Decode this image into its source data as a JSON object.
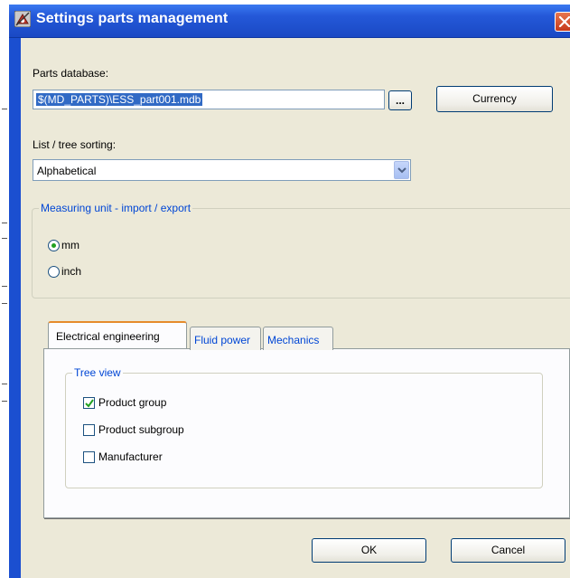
{
  "window": {
    "title": "Settings parts management",
    "app_icon": "settings-parts-icon",
    "close_icon": "close-icon"
  },
  "parts_database": {
    "label": "Parts database:",
    "value": "$(MD_PARTS)\\ESS_part001.mdb",
    "browse_label": "...",
    "currency_label": "Currency"
  },
  "sorting": {
    "label": "List / tree sorting:",
    "selected": "Alphabetical"
  },
  "measuring_unit": {
    "legend": "Measuring unit - import / export",
    "options": [
      {
        "label": "mm",
        "checked": true
      },
      {
        "label": "inch",
        "checked": false
      }
    ]
  },
  "tabs": [
    {
      "label": "Electrical engineering",
      "active": true
    },
    {
      "label": "Fluid power",
      "active": false
    },
    {
      "label": "Mechanics",
      "active": false
    }
  ],
  "tree_view": {
    "legend": "Tree view",
    "items": [
      {
        "label": "Product group",
        "checked": true
      },
      {
        "label": "Product subgroup",
        "checked": false
      },
      {
        "label": "Manufacturer",
        "checked": false
      }
    ]
  },
  "buttons": {
    "ok": "OK",
    "cancel": "Cancel"
  },
  "colors": {
    "titlebar": "#2458d8",
    "client_bg": "#ece9d8",
    "accent_blue": "#0046d5",
    "selection": "#316ac5",
    "radio_dot": "#21a121",
    "tab_highlight": "#e68b2c"
  }
}
